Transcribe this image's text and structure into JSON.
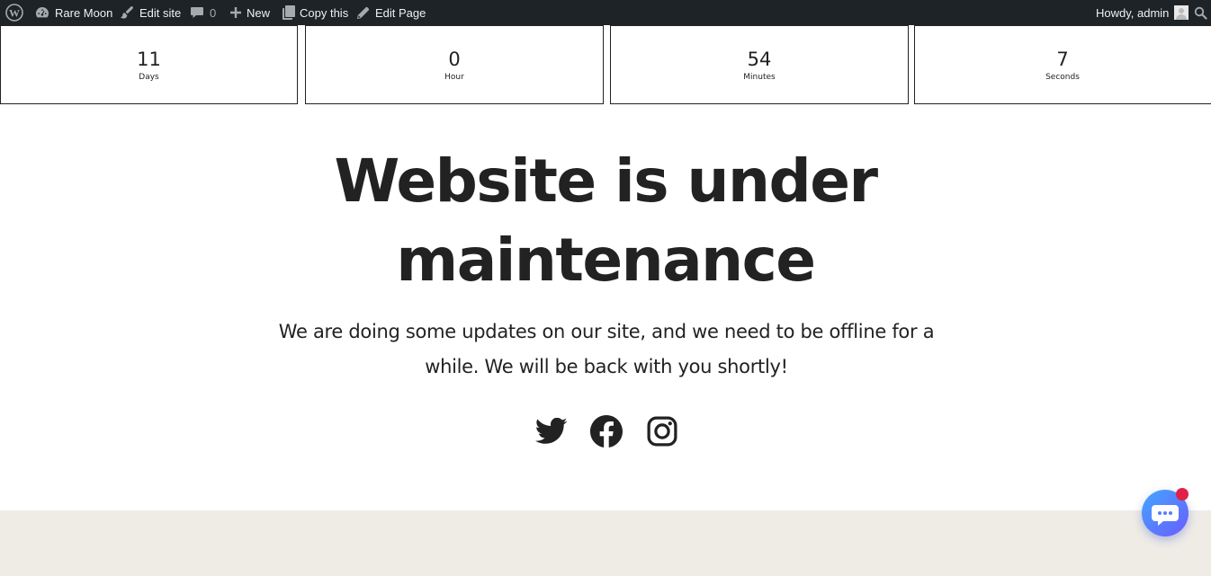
{
  "admin_bar": {
    "site_name": "Rare Moon",
    "edit_site": "Edit site",
    "comments_count": "0",
    "new_label": "New",
    "copy_label": "Copy this",
    "edit_page": "Edit Page",
    "greeting": "Howdy, admin"
  },
  "countdown": [
    {
      "value": "11",
      "label": "Days"
    },
    {
      "value": "0",
      "label": "Hour"
    },
    {
      "value": "54",
      "label": "Minutes"
    },
    {
      "value": "7",
      "label": "Seconds"
    }
  ],
  "hero": {
    "title_line1": "Website is under",
    "title_line2": "maintenance",
    "desc_line1": "We are doing some updates on our site, and we need to be offline for a",
    "desc_line2": "while. We will be back with you shortly!"
  },
  "social": [
    "twitter-icon",
    "facebook-icon",
    "instagram-icon"
  ],
  "colors": {
    "admin_bar_bg": "#1d2327",
    "text": "#222222",
    "footer_band": "#efece6",
    "chat_gradient_start": "#43a6ff",
    "chat_gradient_end": "#6a5cff",
    "notification_badge": "#e0204a"
  }
}
